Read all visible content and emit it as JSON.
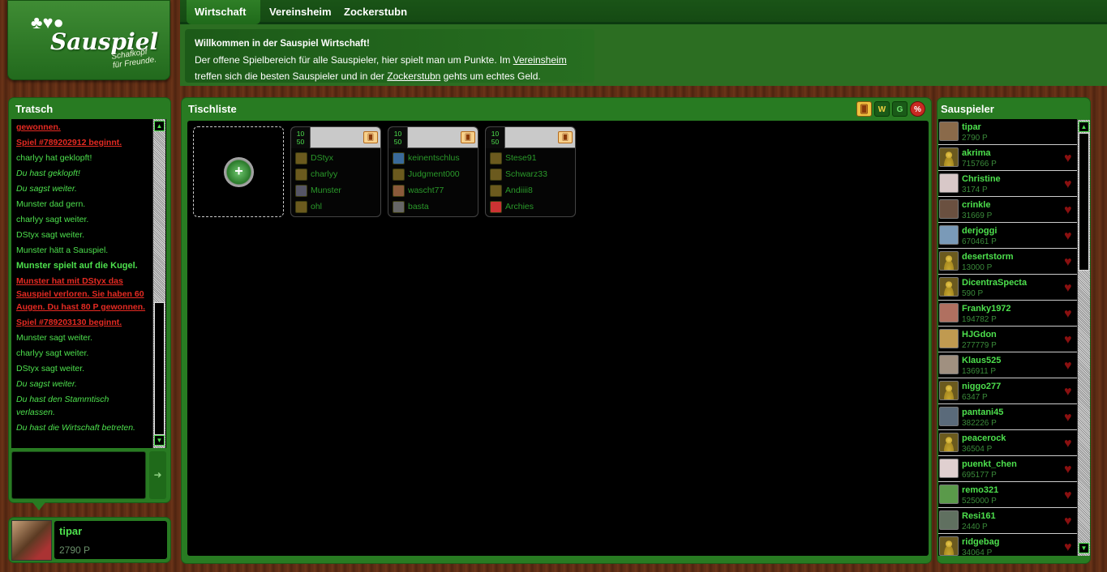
{
  "logo": {
    "name": "Sauspiel",
    "tagline1": "Schafkopf",
    "tagline2": "für Freunde."
  },
  "nav": {
    "tabs": [
      {
        "label": "Wirtschaft"
      },
      {
        "label": "Vereinsheim"
      },
      {
        "label": "Zockerstubn"
      }
    ]
  },
  "welcome": {
    "title": "Willkommen in der Sauspiel Wirtschaft!",
    "text1": "Der offene Spielbereich für alle Sauspieler, hier spielt man um Punkte. Im ",
    "link1": "Vereinsheim",
    "text2": "treffen sich die besten Sauspieler und in der ",
    "link2": "Zockerstubn",
    "text3": " gehts um echtes Geld."
  },
  "tratsch": {
    "title": "Tratsch",
    "messages": [
      {
        "text": "gewonnen.",
        "style": "r"
      },
      {
        "text": "Spiel #789202912 beginnt.",
        "style": "r"
      },
      {
        "text": "charlyy hat geklopft!",
        "style": ""
      },
      {
        "text": "Du hast geklopft!",
        "style": "i"
      },
      {
        "text": "Du sagst weiter.",
        "style": "i"
      },
      {
        "text": "Munster dad gern.",
        "style": ""
      },
      {
        "text": "charlyy sagt weiter.",
        "style": ""
      },
      {
        "text": "DStyx sagt weiter.",
        "style": ""
      },
      {
        "text": "Munster hätt a Sauspiel.",
        "style": ""
      },
      {
        "text": "Munster spielt auf die Kugel.",
        "style": "b"
      },
      {
        "text": "Munster hat mit DStyx das Sauspiel verloren. Sie haben 60 Augen. Du hast 80 P gewonnen.",
        "style": "r"
      },
      {
        "text": "Spiel #789203130 beginnt.",
        "style": "r"
      },
      {
        "text": "Munster sagt weiter.",
        "style": ""
      },
      {
        "text": "charlyy sagt weiter.",
        "style": ""
      },
      {
        "text": "DStyx sagt weiter.",
        "style": ""
      },
      {
        "text": "Du sagst weiter.",
        "style": "i"
      },
      {
        "text": "Du hast den Stammtisch verlassen.",
        "style": "i"
      },
      {
        "text": "Du hast die Wirtschaft betreten.",
        "style": "i"
      }
    ],
    "send_icon": "arrow-right-icon"
  },
  "me": {
    "name": "tipar",
    "points": "2790 P"
  },
  "tischliste": {
    "title": "Tischliste",
    "tables": [
      {
        "stake_top": "10",
        "stake_bottom": "50",
        "players": [
          "DStyx",
          "charlyy",
          "Munster",
          "ohl"
        ]
      },
      {
        "stake_top": "10",
        "stake_bottom": "50",
        "players": [
          "keinentschlus",
          "Judgment000",
          "wascht77",
          "basta"
        ]
      },
      {
        "stake_top": "10",
        "stake_bottom": "50",
        "players": [
          "Stese91",
          "Schwarz33",
          "Andiiii8",
          "Archies"
        ]
      }
    ]
  },
  "sauspieler": {
    "title": "Sauspieler",
    "players": [
      {
        "name": "tipar",
        "points": "2790 P"
      },
      {
        "name": "akrima",
        "points": "715766 P"
      },
      {
        "name": "Christine",
        "points": "3174 P"
      },
      {
        "name": "crinkle",
        "points": "31669 P"
      },
      {
        "name": "derjoggi",
        "points": "670461 P"
      },
      {
        "name": "desertstorm",
        "points": "13000 P"
      },
      {
        "name": "DicentraSpecta",
        "points": "590 P"
      },
      {
        "name": "Franky1972",
        "points": "194782 P"
      },
      {
        "name": "HJGdon",
        "points": "277779 P"
      },
      {
        "name": "Klaus525",
        "points": "136911 P"
      },
      {
        "name": "niggo277",
        "points": "6347 P"
      },
      {
        "name": "pantani45",
        "points": "382226 P"
      },
      {
        "name": "peacerock",
        "points": "36504 P"
      },
      {
        "name": "puenkt_chen",
        "points": "695177 P"
      },
      {
        "name": "remo321",
        "points": "525000 P"
      },
      {
        "name": "Resi161",
        "points": "2440 P"
      },
      {
        "name": "ridgebag",
        "points": "34064 P"
      }
    ]
  }
}
